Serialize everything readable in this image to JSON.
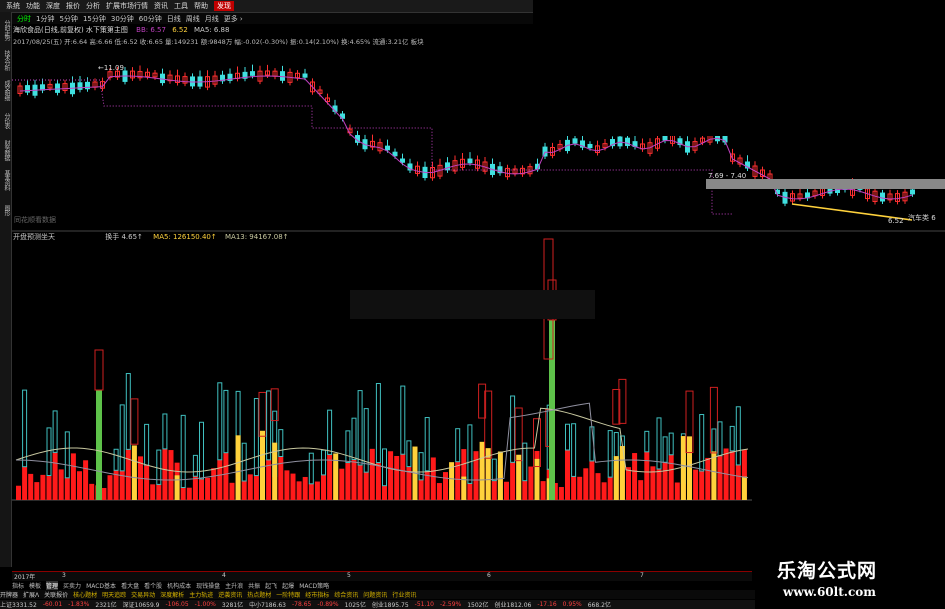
{
  "menu": [
    "系统",
    "功能",
    "深度",
    "报价",
    "分析",
    "扩展市场行情",
    "资讯",
    "工具",
    "帮助",
    "发现"
  ],
  "periods": [
    "分时",
    "1分钟",
    "5分钟",
    "15分钟",
    "30分钟",
    "60分钟",
    "日线",
    "周线",
    "月线",
    "更多 ›"
  ],
  "sidebar_tabs": [
    "分时走势",
    "技术分析",
    "成交明细",
    "分价表",
    "财务数据",
    "基本资料",
    "图形"
  ],
  "stock_info": {
    "title_line": "海欣食品(日线,前复权)  水下策第主图",
    "bb_label": "BB:",
    "bb_value": "6.57",
    "value2": "6.52",
    "ma5": "MA5: 6.88",
    "detail_line": "2017/08/25(五) 开:6.64 高:6.66 低:6.52 收:6.65 量:149231 额:9848万 幅:-0.02(-0.30%) 振:0.14(2.10%) 换:4.65% 流通:3.21亿 板块"
  },
  "price_annotations": {
    "high": "←11.09",
    "range": "7.69 - 7.40",
    "low": "6.52",
    "flag": "汽车类 6",
    "watermark": "同花顺看数据"
  },
  "volume_panel": {
    "title": "开盘预测坐天",
    "turnover_label": "换手",
    "turnover_value": "4.65↑",
    "ma5": "MA5: 126150.40↑",
    "ma13": "MA13: 94167.08↑"
  },
  "date_axis": [
    "2017年",
    "3",
    "4",
    "5",
    "6",
    "7"
  ],
  "tabs_row1": [
    "指标",
    "模板",
    "管理",
    "买卖力",
    "MACD基本",
    "看大盘",
    "看个股",
    "机构成本",
    "现钱操盘",
    "主升浪",
    "共振",
    "起飞",
    "起爆",
    "MACD策略"
  ],
  "tabs_row2": [
    "开牌器",
    "扩展Λ",
    "关联报价",
    "核心题材",
    "明天追踪",
    "交易异动",
    "深度解析",
    "主力轨迹",
    "逆袭资讯",
    "热点题材",
    "一阶特跟",
    "经市指标",
    "综合资讯",
    "问题资讯",
    "行业资讯"
  ],
  "statusbar": [
    "上证3331.52",
    "-60.01",
    "-1.83%",
    "2321亿",
    "深证10659.9",
    "-106.05",
    "-1.00%",
    "3281亿",
    "中小7186.63",
    "-78.65",
    "-0.89%",
    "1025亿",
    "创业1895.75",
    "-51.10",
    "-2.59%",
    "1502亿",
    "创业1812.06",
    "-17.16",
    "0.95%",
    "668.2亿"
  ],
  "logo": {
    "text": "乐淘公式网",
    "url": "www.60lt.com"
  },
  "colors": {
    "up": "#ff2b2b",
    "down": "#40e0e0",
    "gold": "#ffd23c",
    "green": "#5ec24a",
    "ma": "#c040c0",
    "line": "#c8c8a0"
  }
}
